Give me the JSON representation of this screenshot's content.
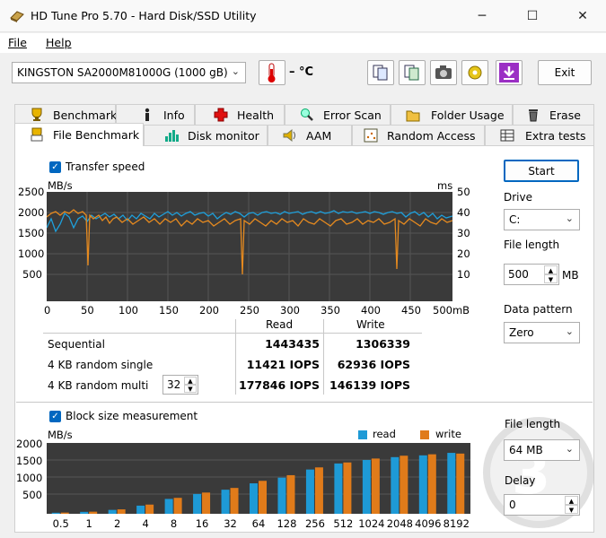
{
  "app": {
    "title": "HD Tune Pro 5.70 - Hard Disk/SSD Utility",
    "minimize": "─",
    "maximize": "☐",
    "close": "✕"
  },
  "menu": {
    "file": "File",
    "help": "Help"
  },
  "toolbar": {
    "drive": "KINGSTON SA2000M81000G (1000 gB)",
    "temp": "– °C",
    "exit": "Exit"
  },
  "tabs_top": [
    "Benchmark",
    "Info",
    "Health",
    "Error Scan",
    "Folder Usage",
    "Erase"
  ],
  "tabs_bottom": [
    "File Benchmark",
    "Disk monitor",
    "AAM",
    "Random Access",
    "Extra tests"
  ],
  "transfer": {
    "label": "Transfer speed",
    "left_unit": "MB/s",
    "right_unit": "ms",
    "y_left": [
      "2500",
      "2000",
      "1500",
      "1000",
      "500"
    ],
    "y_right": [
      "50",
      "40",
      "30",
      "20",
      "10"
    ],
    "x_ticks": [
      "0",
      "50",
      "100",
      "150",
      "200",
      "250",
      "300",
      "350",
      "400",
      "450",
      "500mB"
    ]
  },
  "results": {
    "col_read": "Read",
    "col_write": "Write",
    "rows": [
      {
        "label": "Sequential",
        "read": "1443435",
        "write": "1306339"
      },
      {
        "label": "4 KB random single",
        "read": "11421 IOPS",
        "write": "62936 IOPS"
      },
      {
        "label": "4 KB random multi",
        "read": "177846 IOPS",
        "write": "146139 IOPS"
      }
    ],
    "queue": "32"
  },
  "side": {
    "start": "Start",
    "drive_label": "Drive",
    "drive_value": "C:",
    "file_length_label": "File length",
    "file_length_value": "500",
    "file_length_unit": "MB",
    "pattern_label": "Data pattern",
    "pattern_value": "Zero"
  },
  "block": {
    "label": "Block size measurement",
    "unit": "MB/s",
    "legend_read": "read",
    "legend_write": "write",
    "y_ticks": [
      "2000",
      "1500",
      "1000",
      "500"
    ],
    "file_length_label": "File length",
    "file_length_value": "64 MB",
    "delay_label": "Delay",
    "delay_value": "0"
  },
  "chart_data": {
    "type": "bar",
    "ylabel": "MB/s",
    "ylim": [
      0,
      2000
    ],
    "categories": [
      "0.5",
      "1",
      "2",
      "4",
      "8",
      "16",
      "32",
      "64",
      "128",
      "256",
      "512",
      "1024",
      "2048",
      "4096",
      "8192"
    ],
    "series": [
      {
        "name": "read",
        "values": [
          30,
          55,
          110,
          230,
          420,
          560,
          680,
          860,
          1020,
          1250,
          1420,
          1520,
          1600,
          1650,
          1720
        ]
      },
      {
        "name": "write",
        "values": [
          35,
          60,
          125,
          260,
          450,
          600,
          730,
          930,
          1090,
          1310,
          1450,
          1560,
          1640,
          1680,
          1700
        ]
      }
    ]
  },
  "colors": {
    "read": "#1e9ad6",
    "write": "#e07b1a",
    "accent": "#0067c0"
  }
}
